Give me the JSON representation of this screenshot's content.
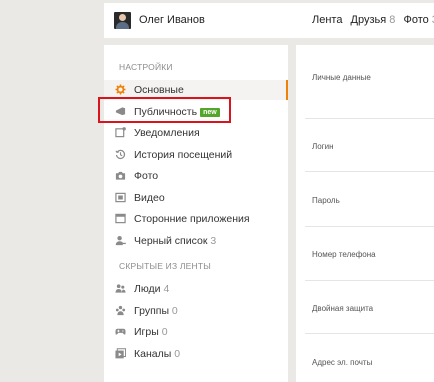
{
  "header": {
    "user_name": "Олег Иванов",
    "nav": [
      {
        "label": "Лента",
        "count": ""
      },
      {
        "label": "Друзья",
        "count": "8"
      },
      {
        "label": "Фото",
        "count": "3"
      }
    ]
  },
  "sidebar": {
    "settings_title": "НАСТРОЙКИ",
    "hidden_title": "СКРЫТЫЕ ИЗ ЛЕНТЫ",
    "badge_new": "new",
    "items": [
      {
        "label": "Основные",
        "icon": "gear-icon",
        "active": true
      },
      {
        "label": "Публичность",
        "icon": "megaphone-icon"
      },
      {
        "label": "Уведомления",
        "icon": "notification-icon"
      },
      {
        "label": "История посещений",
        "icon": "history-icon"
      },
      {
        "label": "Фото",
        "icon": "camera-icon"
      },
      {
        "label": "Видео",
        "icon": "video-icon"
      },
      {
        "label": "Сторонние приложения",
        "icon": "apps-icon"
      },
      {
        "label": "Черный список",
        "count": "3",
        "icon": "blacklist-icon"
      }
    ],
    "hidden_items": [
      {
        "label": "Люди",
        "count": "4",
        "icon": "people-icon"
      },
      {
        "label": "Группы",
        "count": "0",
        "icon": "groups-icon"
      },
      {
        "label": "Игры",
        "count": "0",
        "icon": "gamepad-icon"
      },
      {
        "label": "Каналы",
        "count": "0",
        "icon": "channels-icon"
      }
    ]
  },
  "content": {
    "fields": [
      "Личные данные",
      "Логин",
      "Пароль",
      "Номер телефона",
      "Двойная защита",
      "Адрес эл. почты"
    ]
  },
  "colors": {
    "accent": "#ee8208",
    "badge": "#54a62a",
    "highlight": "#d9141d"
  }
}
